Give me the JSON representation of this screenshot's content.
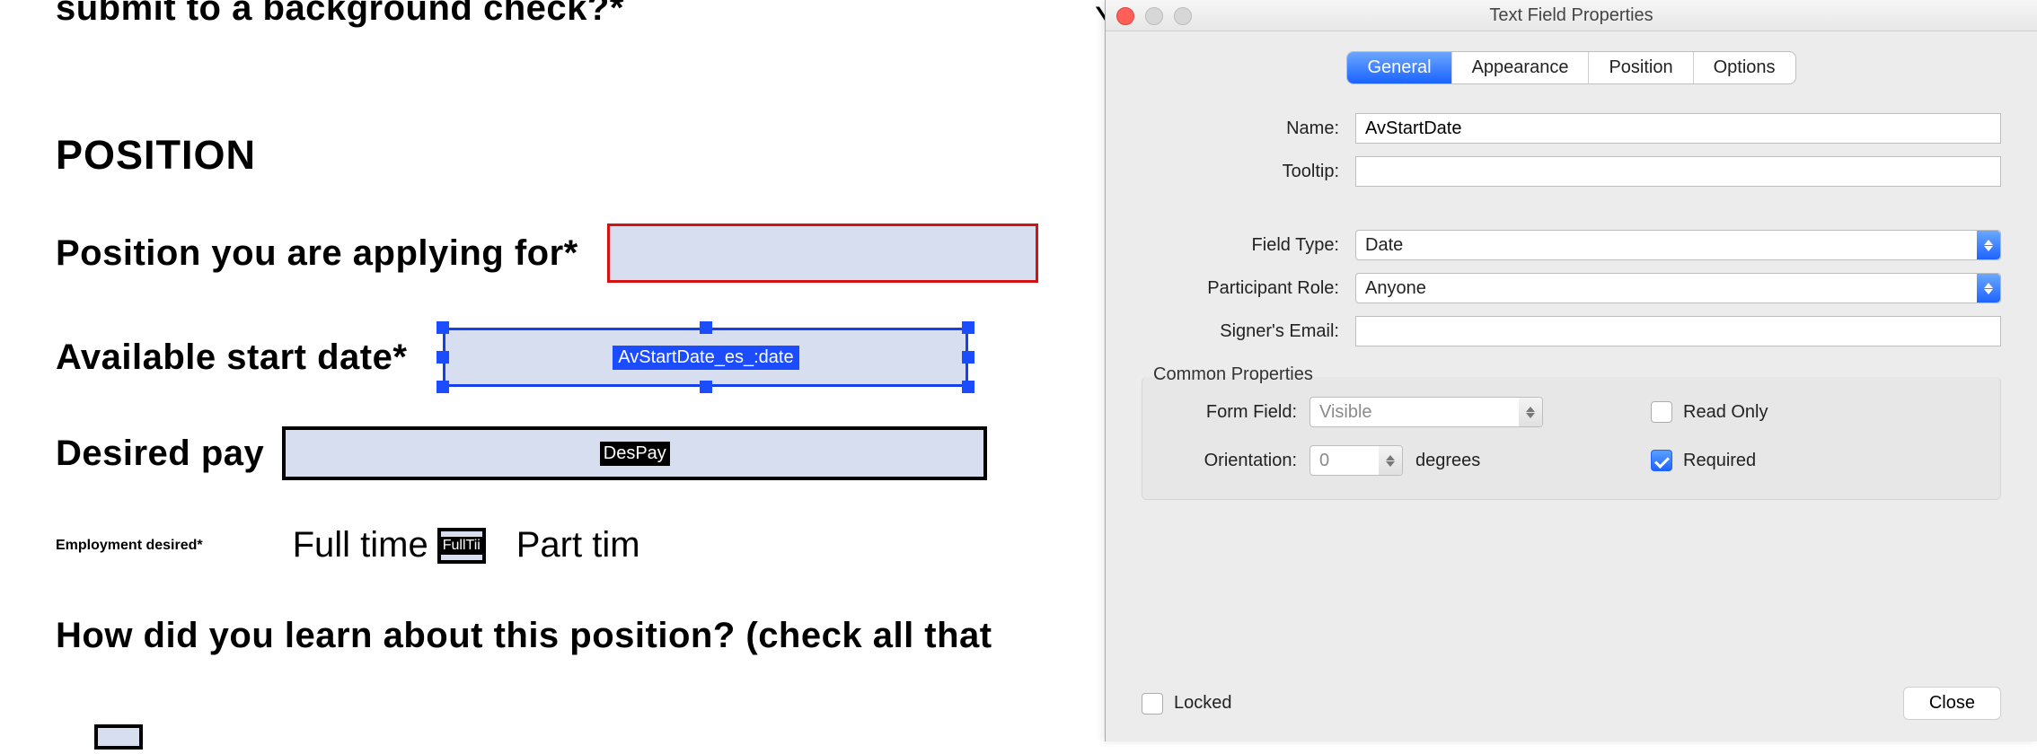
{
  "doc": {
    "line1": "submit to a background check?*",
    "y_fragment": "Y",
    "section_header": "POSITION",
    "rows": {
      "position": {
        "label": "Position you are applying for*"
      },
      "start_date": {
        "label": "Available start date*",
        "field_tag": "AvStartDate_es_:date"
      },
      "desired_pay": {
        "label": "Desired pay",
        "field_tag": "DesPay"
      },
      "employment": {
        "label": "Employment desired*",
        "opt_full": "Full time",
        "opt_full_tag": "FullTii",
        "opt_part": "Part tim"
      },
      "learn": {
        "label": "How did you learn about this position? (check all that"
      }
    }
  },
  "panel": {
    "title": "Text Field Properties",
    "tabs": {
      "general": "General",
      "appearance": "Appearance",
      "position": "Position",
      "options": "Options"
    },
    "labels": {
      "name": "Name:",
      "tooltip": "Tooltip:",
      "field_type": "Field Type:",
      "participant_role": "Participant Role:",
      "signers_email": "Signer's Email:",
      "common_properties": "Common Properties",
      "form_field": "Form Field:",
      "orientation": "Orientation:",
      "degrees": "degrees",
      "read_only": "Read Only",
      "required": "Required",
      "locked": "Locked",
      "close": "Close"
    },
    "values": {
      "name": "AvStartDate",
      "tooltip": "",
      "field_type": "Date",
      "participant_role": "Anyone",
      "signers_email": "",
      "form_field": "Visible",
      "orientation": "0",
      "read_only_checked": false,
      "required_checked": true,
      "locked_checked": false
    }
  }
}
